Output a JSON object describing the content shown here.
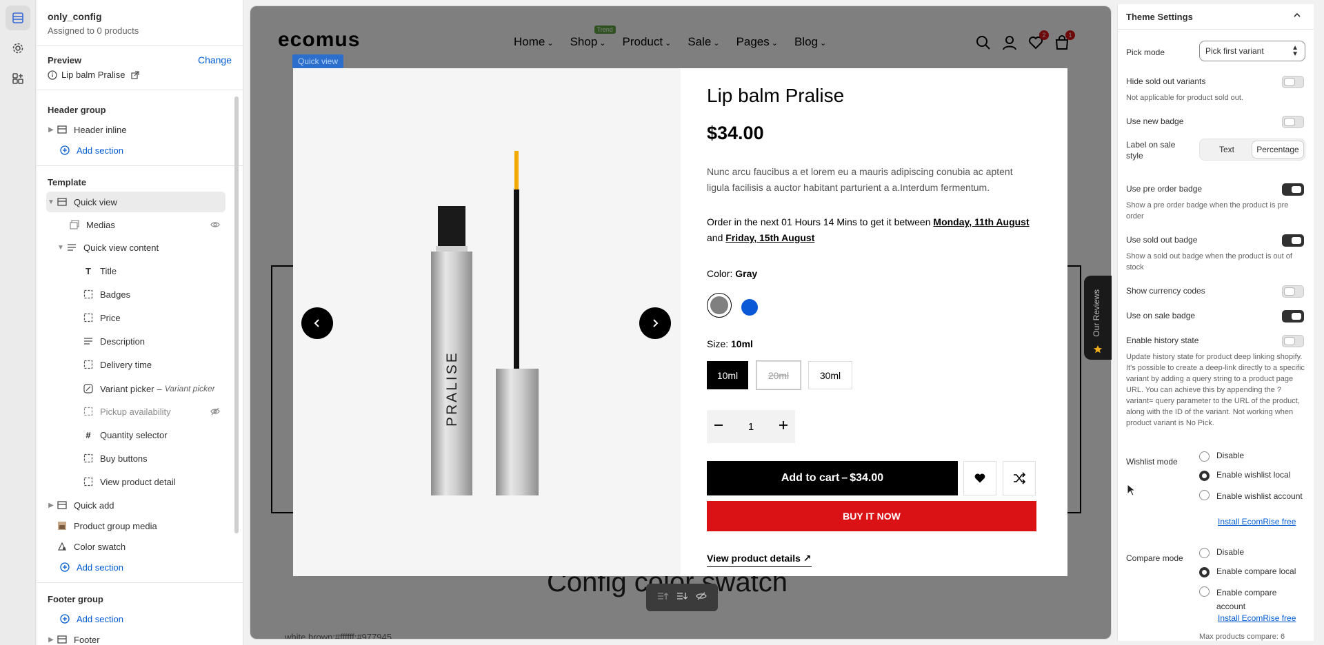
{
  "left_panel": {
    "title": "only_config",
    "subtitle": "Assigned to 0 products",
    "preview_label": "Preview",
    "change_label": "Change",
    "preview_product": "Lip balm Pralise",
    "header_group_label": "Header group",
    "header_items": [
      {
        "label": "Header inline"
      }
    ],
    "add_section": "Add section",
    "template_label": "Template",
    "template_items": [
      {
        "label": "Quick view"
      },
      {
        "label": "Medias"
      },
      {
        "label": "Quick view content"
      },
      {
        "label": "Title"
      },
      {
        "label": "Badges"
      },
      {
        "label": "Price"
      },
      {
        "label": "Description"
      },
      {
        "label": "Delivery time"
      },
      {
        "label": "Variant picker",
        "note": "Variant picker"
      },
      {
        "label": "Pickup availability"
      },
      {
        "label": "Quantity selector"
      },
      {
        "label": "Buy buttons"
      },
      {
        "label": "View product detail"
      },
      {
        "label": "Quick add"
      },
      {
        "label": "Product group media"
      },
      {
        "label": "Color swatch"
      }
    ],
    "footer_group_label": "Footer group",
    "footer_items": [
      {
        "label": "Footer"
      }
    ],
    "dash": "–"
  },
  "store": {
    "logo": "ecomus",
    "nav": [
      {
        "label": "Home"
      },
      {
        "label": "Shop",
        "tag": "Trend"
      },
      {
        "label": "Product"
      },
      {
        "label": "Sale"
      },
      {
        "label": "Pages"
      },
      {
        "label": "Blog"
      }
    ],
    "wishlist_count": "2",
    "cart_count": "1",
    "quick_view_tag": "Quick view",
    "bg_title": "Config color swatch",
    "bg_sub": "white brown:#ffffff:#977945",
    "reviews_label": "Our Reviews"
  },
  "product": {
    "image_brand": "PRALISE",
    "title": "Lip balm Pralise",
    "price": "$34.00",
    "description": "Nunc arcu faucibus a et lorem eu a mauris adipiscing conubia ac aptent ligula facilisis a auctor habitant parturient a a.Interdum fermentum.",
    "delivery_prefix": "Order in the next 01 Hours 14 Mins to get it between",
    "delivery_date1": "Monday, 11th August",
    "delivery_and": "and",
    "delivery_date2": "Friday, 15th August",
    "color_label": "Color:",
    "color_value": "Gray",
    "swatch_colors": [
      "#808080",
      "#0a58d6"
    ],
    "size_label": "Size:",
    "size_value": "10ml",
    "sizes": [
      {
        "label": "10ml"
      },
      {
        "label": "20ml"
      },
      {
        "label": "30ml"
      }
    ],
    "quantity": "1",
    "add_to_cart": "Add to cart",
    "add_to_cart_price": "$34.00",
    "buy_now": "BUY IT NOW",
    "view_details": "View product details"
  },
  "theme_settings": {
    "title": "Theme Settings",
    "pick_mode_label": "Pick mode",
    "pick_mode_value": "Pick first variant",
    "hide_sold_out_label": "Hide sold out variants",
    "hide_sold_out_help": "Not applicable for product sold out.",
    "use_new_badge_label": "Use new badge",
    "label_sale_style_label": "Label on sale style",
    "seg_text": "Text",
    "seg_percentage": "Percentage",
    "pre_order_label": "Use pre order badge",
    "pre_order_help": "Show a pre order badge when the product is pre order",
    "sold_out_badge_label": "Use sold out badge",
    "sold_out_badge_help": "Show a sold out badge when the product is out of stock",
    "currency_codes_label": "Show currency codes",
    "on_sale_badge_label": "Use on sale badge",
    "history_state_label": "Enable history state",
    "history_state_help": "Update history state for product deep linking shopify. It's possible to create a deep-link directly to a specific variant by adding a query string to a product page URL. You can achieve this by appending the ?variant= query parameter to the URL of the product, along with the ID of the variant. Not working when product variant is No Pick.",
    "wishlist_mode_label": "Wishlist mode",
    "wishlist_options": [
      "Disable",
      "Enable wishlist local",
      "Enable wishlist account"
    ],
    "install_link": "Install EcomRise free",
    "compare_mode_label": "Compare mode",
    "compare_options": [
      "Disable",
      "Enable compare local",
      "Enable compare account"
    ],
    "max_compare": "Max products compare: 6"
  },
  "colors": {
    "accent_red": "#db1215",
    "link_blue": "#005bd3",
    "trend_green": "#5ea441"
  }
}
